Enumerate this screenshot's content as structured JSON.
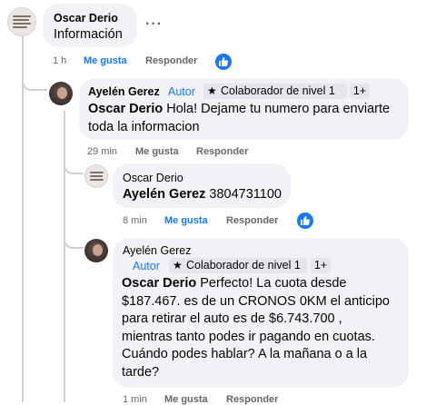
{
  "comment1": {
    "author": "Oscar Derio",
    "text": "Información",
    "time": "1 h",
    "like_label": "Me gusta",
    "reply_label": "Responder",
    "more": "···"
  },
  "reply1": {
    "author": "Ayelén Gerez",
    "author_tag": "Autor",
    "badge": "Colaborador de nivel 1",
    "badge_icon": "star-icon",
    "plus": "1+",
    "mention": "Oscar Derio",
    "text_line1": "Hola! Dejame tu numero para enviarte",
    "text_line2": "toda la informacion",
    "time": "29 min",
    "like_label": "Me gusta",
    "reply_label": "Responder"
  },
  "reply2": {
    "author": "Oscar Derio",
    "mention": "Ayelén Gerez",
    "text": "3804731100",
    "time": "8 min",
    "like_label": "Me gusta",
    "reply_label": "Responder"
  },
  "reply3": {
    "author": "Ayelén Gerez",
    "author_tag": "Autor",
    "badge": "Colaborador de nivel 1",
    "plus": "1+",
    "mention": "Oscar Derio",
    "lines": [
      " Perfecto! La cuota desde",
      "$187.467. es de un CRONOS 0KM el anticipo",
      "para retirar el auto es de $6.743.700 ,",
      "mientras tanto podes ir pagando en cuotas.",
      "Cuándo podes hablar? A la mañana o a la",
      "tarde?"
    ],
    "time": "1 min",
    "like_label": "Me gusta",
    "reply_label": "Responder"
  },
  "colors": {
    "link_blue": "#1877f2",
    "bubble": "#f0f2f5",
    "meta": "#65676b",
    "thread_line": "#ced0d4"
  }
}
